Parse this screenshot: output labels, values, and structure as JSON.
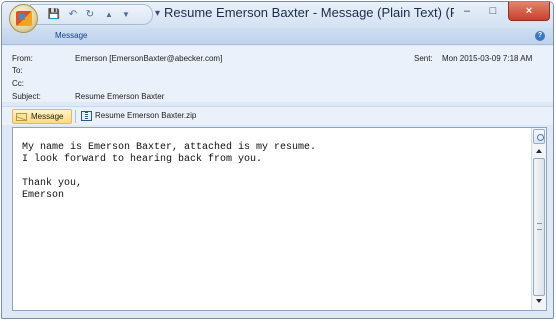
{
  "window": {
    "title": "Resume Emerson Baxter - Message (Plain Text) (Read-...",
    "minimize_glyph": "–",
    "maximize_glyph": "□",
    "close_glyph": "×"
  },
  "quick_access": {
    "save_glyph": "💾",
    "undo_glyph": "↶",
    "redo_glyph": "↻",
    "up_glyph": "▲",
    "down_glyph": "▼",
    "customize_glyph": "▾"
  },
  "ribbon": {
    "tabs": [
      {
        "label": "Message"
      }
    ],
    "help_glyph": "?"
  },
  "header": {
    "from_label": "From:",
    "from_value": "Emerson [EmersonBaxter@abecker.com]",
    "to_label": "To:",
    "to_value": "",
    "cc_label": "Cc:",
    "cc_value": "",
    "subject_label": "Subject:",
    "subject_value": "Resume Emerson Baxter",
    "sent_label": "Sent:",
    "sent_value": "Mon 2015-03-09 7:18 AM"
  },
  "attachments": {
    "message_label": "Message",
    "files": [
      {
        "name": "Resume Emerson Baxter.zip"
      }
    ]
  },
  "body": {
    "text": "My name is Emerson Baxter, attached is my resume.\nI look forward to hearing back from you.\n\nThank you,\nEmerson"
  },
  "colors": {
    "titlebar": "#d3e1f2",
    "ribbon": "#bfd3ec",
    "header_bg": "#eaf1fa",
    "accent_blue": "#15428b",
    "close_red": "#c8402a"
  }
}
